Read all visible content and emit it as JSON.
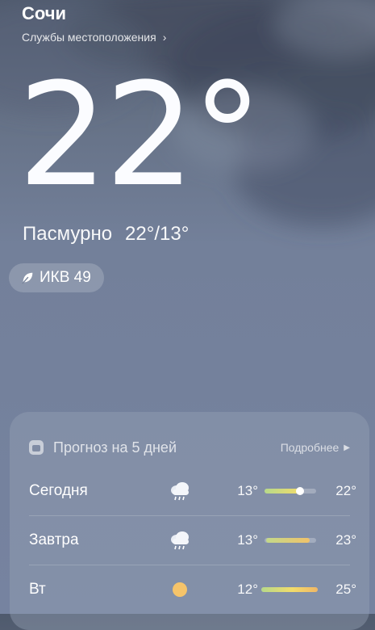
{
  "location": {
    "city": "Сочи",
    "services_label": "Службы местоположения",
    "chevron": "›"
  },
  "current": {
    "temp": "22",
    "degree": "°",
    "condition": "Пасмурно",
    "range": "22°/13°"
  },
  "aqi": {
    "label": "ИКВ 49",
    "icon": "leaf-icon"
  },
  "forecast": {
    "title": "Прогноз на 5 дней",
    "more_label": "Подробнее",
    "days": [
      {
        "day": "Сегодня",
        "icon": "rain-cloud-icon",
        "low": "13°",
        "high": "22°",
        "current_marker": true
      },
      {
        "day": "Завтра",
        "icon": "rain-cloud-icon",
        "low": "13°",
        "high": "23°"
      },
      {
        "day": "Вт",
        "icon": "sun-icon",
        "low": "12°",
        "high": "25°"
      }
    ]
  },
  "colors": {
    "bar_yellow": "#f2dc6a",
    "bar_green": "#b7d98a",
    "bar_orange": "#f0b766",
    "sun": "#f6c46a"
  }
}
